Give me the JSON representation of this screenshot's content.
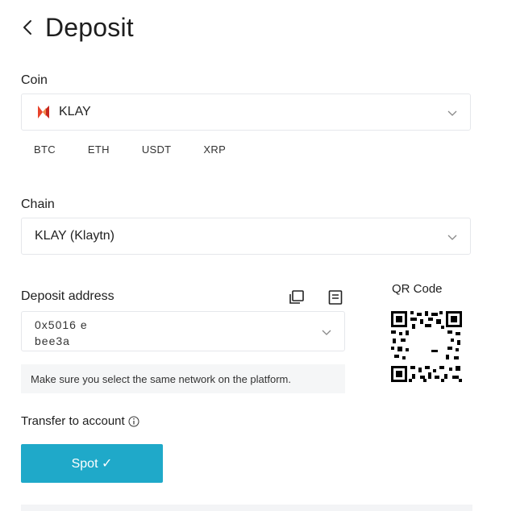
{
  "header": {
    "title": "Deposit"
  },
  "coin": {
    "label": "Coin",
    "selected": "KLAY",
    "icon": "klaytn-logo-icon",
    "quick": [
      "BTC",
      "ETH",
      "USDT",
      "XRP"
    ]
  },
  "chain": {
    "label": "Chain",
    "selected": "KLAY (Klaytn)"
  },
  "deposit": {
    "label": "Deposit address",
    "address_line1": "0x5016            e",
    "address_line2": "bee3a",
    "note": "Make sure you select the same network on the platform."
  },
  "qr": {
    "label": "QR Code"
  },
  "transfer": {
    "label": "Transfer to account"
  },
  "spot": {
    "label": "Spot ✓"
  },
  "colors": {
    "accent": "#1fa9c9",
    "klay_logo": "#e8432b"
  }
}
